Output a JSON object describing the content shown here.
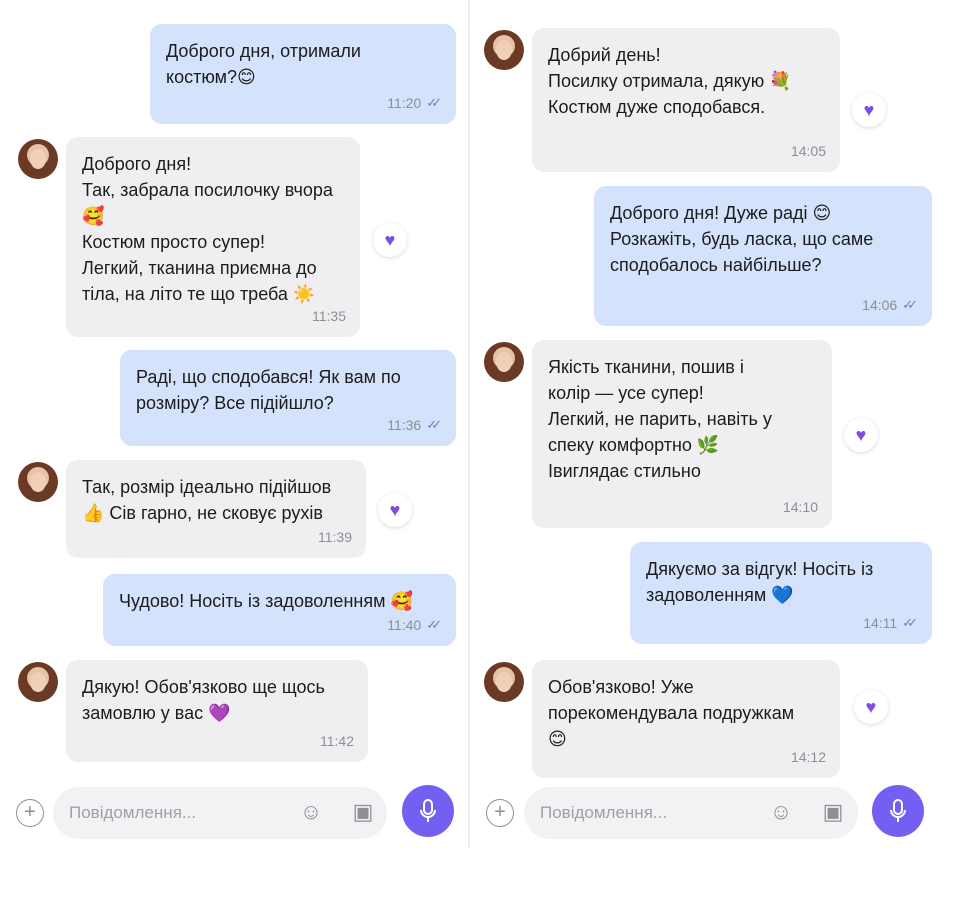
{
  "left": {
    "messages": [
      {
        "side": "out",
        "text": "Доброго дня, отримали\nкостюм?😊",
        "time": "11:20"
      },
      {
        "side": "in",
        "text": "Доброго дня!\nТак, забрала посилочку вчора\n🥰\nКостюм просто супер!\nЛегкий, тканина приємна до\nтіла, на літо те що треба ☀️",
        "time": "11:35",
        "reaction": "♥"
      },
      {
        "side": "out",
        "text": "Раді, що сподобався! Як вам по\nрозміру? Все підійшло?",
        "time": "11:36"
      },
      {
        "side": "in",
        "text": "Так, розмір ідеально підійшов\n👍 Сів гарно, не сковує рухів",
        "time": "11:39",
        "reaction": "♥"
      },
      {
        "side": "out",
        "text": "Чудово! Носіть із задоволенням 🥰",
        "time": "11:40"
      },
      {
        "side": "in",
        "text": "Дякую! Обов'язково ще щось\nзамовлю у вас 💜",
        "time": "11:42"
      }
    ],
    "composer": {
      "placeholder": "Повідомлення..."
    }
  },
  "right": {
    "messages": [
      {
        "side": "in",
        "text": "Добрий день!\nПосилку отримала, дякую 💐\nКостюм дуже сподобався.",
        "time": "14:05",
        "reaction": "♥"
      },
      {
        "side": "out",
        "text": "Доброго дня! Дуже раді 😊\nРозкажіть, будь ласка, що саме\nсподобалось найбільше?",
        "time": "14:06"
      },
      {
        "side": "in",
        "text": "Якість тканини, пошив і\nколір — усе супер!\nЛегкий, не парить, навіть у\nспеку комфортно 🌿\nІвиглядає стильно",
        "time": "14:10",
        "reaction": "♥"
      },
      {
        "side": "out",
        "text": "Дякуємо за відгук! Носіть із\nзадоволенням 💙",
        "time": "14:11"
      },
      {
        "side": "in",
        "text": "Обов'язково! Уже\nпорекомендувала подружкам\n😊",
        "time": "14:12",
        "reaction": "♥"
      }
    ],
    "composer": {
      "placeholder": "Повідомлення..."
    }
  },
  "icons": {
    "ticks": "✓✓",
    "plus": "+",
    "emoji": "☺",
    "sticker": "▣"
  },
  "colors": {
    "outgoing": "#d4e2fb",
    "incoming": "#efeff1",
    "accent": "#7360f2",
    "reaction": "#7a4fe0"
  }
}
